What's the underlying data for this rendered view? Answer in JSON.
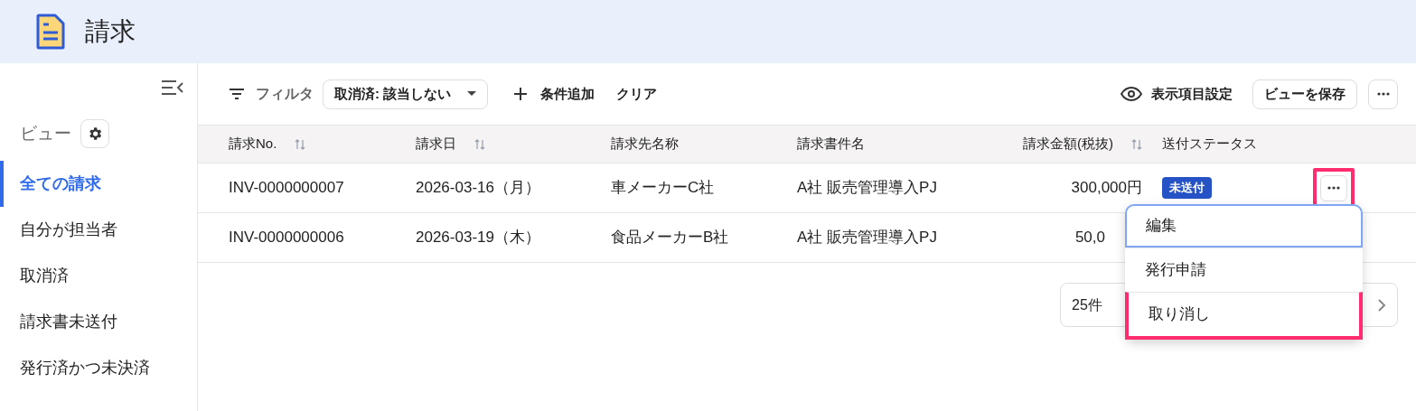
{
  "header": {
    "title": "請求"
  },
  "sidebar": {
    "view_label": "ビュー",
    "items": [
      {
        "label": "全ての請求",
        "selected": true
      },
      {
        "label": "自分が担当者",
        "selected": false
      },
      {
        "label": "取消済",
        "selected": false
      },
      {
        "label": "請求書未送付",
        "selected": false
      },
      {
        "label": "発行済かつ未決済",
        "selected": false
      }
    ]
  },
  "toolbar": {
    "filter_label": "フィルタ",
    "filter_chip": "取消済: 該当しない",
    "add_condition": "条件追加",
    "clear": "クリア",
    "column_settings": "表示項目設定",
    "save_view": "ビューを保存"
  },
  "table": {
    "columns": [
      {
        "label": "請求No.",
        "sortable": true
      },
      {
        "label": "請求日",
        "sortable": true
      },
      {
        "label": "請求先名称",
        "sortable": false
      },
      {
        "label": "請求書件名",
        "sortable": false
      },
      {
        "label": "請求金額(税抜)",
        "sortable": true
      },
      {
        "label": "送付ステータス",
        "sortable": false
      }
    ],
    "rows": [
      {
        "cells": [
          "INV-0000000007",
          "2026-03-16（月）",
          "車メーカーC社",
          "A社 販売管理導入PJ",
          "300,000円"
        ],
        "status": "未送付",
        "actions_annotated": true,
        "amount_cut": false
      },
      {
        "cells": [
          "INV-0000000006",
          "2026-03-19（木）",
          "食品メーカーB社",
          "A社 販売管理導入PJ",
          "50,0"
        ],
        "amount_cut": true
      }
    ]
  },
  "pagination": {
    "page_size": "25件"
  },
  "menu": {
    "items": [
      {
        "label": "編集",
        "focused": true,
        "annotated": false
      },
      {
        "label": "発行申請",
        "focused": false,
        "annotated": false
      },
      {
        "label": "取り消し",
        "focused": false,
        "annotated": true
      }
    ]
  }
}
